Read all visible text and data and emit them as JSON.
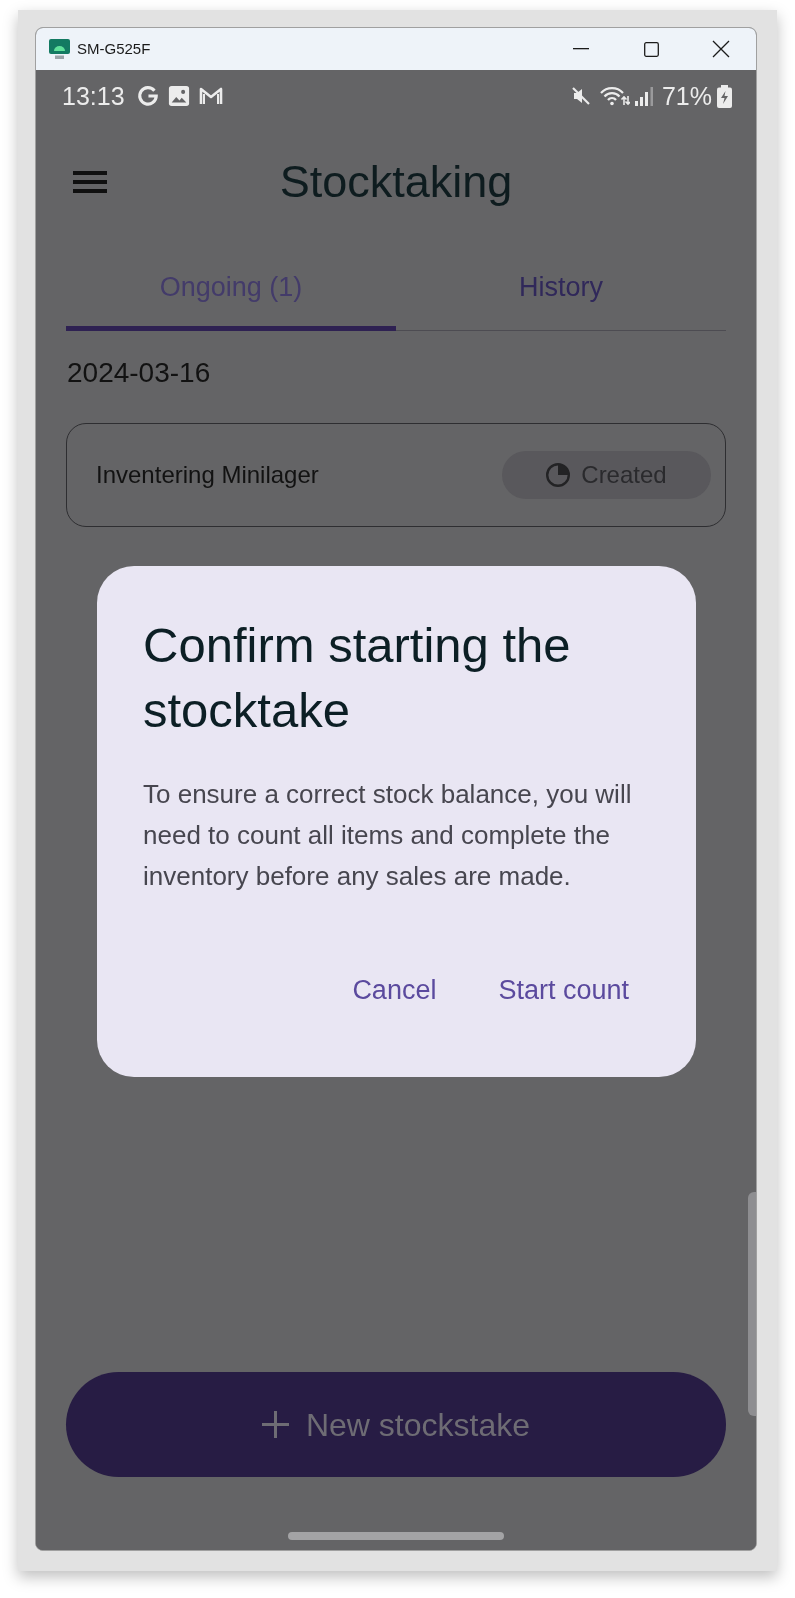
{
  "window": {
    "title": "SM-G525F"
  },
  "status_bar": {
    "time": "13:13",
    "battery": "71%"
  },
  "app_bar": {
    "title": "Stocktaking"
  },
  "tabs": [
    {
      "label": "Ongoing (1)",
      "selected": true
    },
    {
      "label": "History",
      "selected": false
    }
  ],
  "groups": [
    {
      "date": "2024-03-16",
      "items": [
        {
          "name": "Inventering Minilager",
          "status": "Created"
        }
      ]
    }
  ],
  "dialog": {
    "title": "Confirm starting the stocktake",
    "message": "To ensure a correct stock balance, you will need to count all items and complete the inventory before any sales are made.",
    "buttons": [
      "Cancel",
      "Start count"
    ]
  },
  "fab": {
    "label": "New stockstake"
  }
}
